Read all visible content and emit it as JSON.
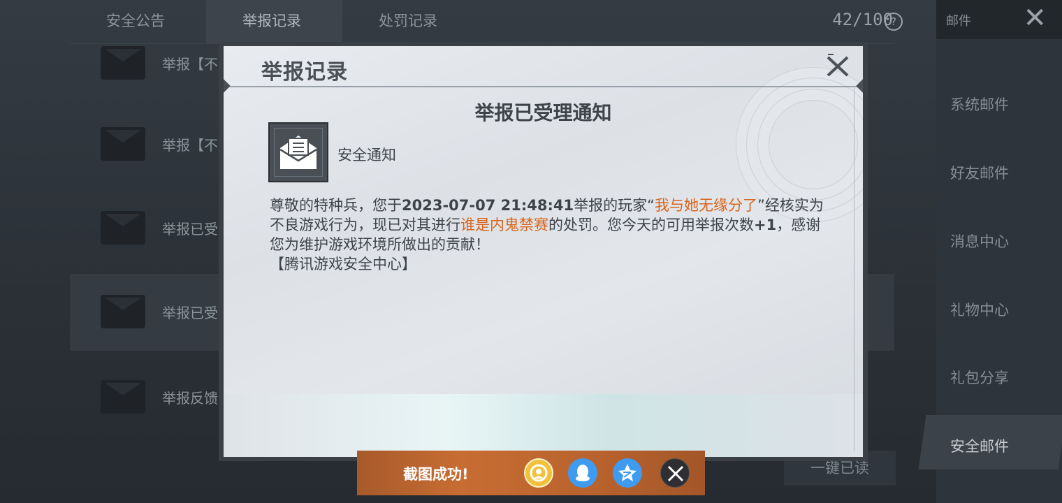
{
  "background": {
    "tabs": [
      {
        "label": "安全公告"
      },
      {
        "label": "举报记录"
      },
      {
        "label": "处罚记录"
      }
    ],
    "counter": "42/100",
    "rows": [
      {
        "label": "举报【不"
      },
      {
        "label": "举报【不"
      },
      {
        "label": "举报已受"
      },
      {
        "label": "举报已受"
      },
      {
        "label": "举报反馈"
      }
    ],
    "sidebar": {
      "title": "邮件",
      "items": [
        {
          "label": "系统邮件"
        },
        {
          "label": "好友邮件"
        },
        {
          "label": "消息中心"
        },
        {
          "label": "礼物中心"
        },
        {
          "label": "礼包分享"
        },
        {
          "label": "安全邮件"
        }
      ]
    },
    "read_all_label": "一键已读"
  },
  "dialog": {
    "title": "举报记录",
    "heading": "举报已受理通知",
    "sender": "安全通知",
    "body": {
      "p1": "尊敬的特种兵，您于",
      "datetime": "2023-07-07 21:48:41",
      "p2": "举报的玩家“",
      "player": "我与她无缘分了",
      "p3": "”经核实为不良游戏行为，现已对其进行",
      "penalty": "谁是内鬼禁赛",
      "p4": "的处罚。您今天的可用举报次数",
      "plus": "+1",
      "p5": "，感谢您为维护游戏环境所做出的贡献！",
      "signature": "【腾讯游戏安全中心】"
    }
  },
  "toast": {
    "text": "截图成功!",
    "share_targets": [
      {
        "icon": "wangzhe-icon"
      },
      {
        "icon": "qq-icon"
      },
      {
        "icon": "qzone-icon"
      },
      {
        "icon": "close-icon"
      }
    ]
  },
  "colors": {
    "highlight": "#d8651c",
    "toast_bg": "#c76d33"
  }
}
